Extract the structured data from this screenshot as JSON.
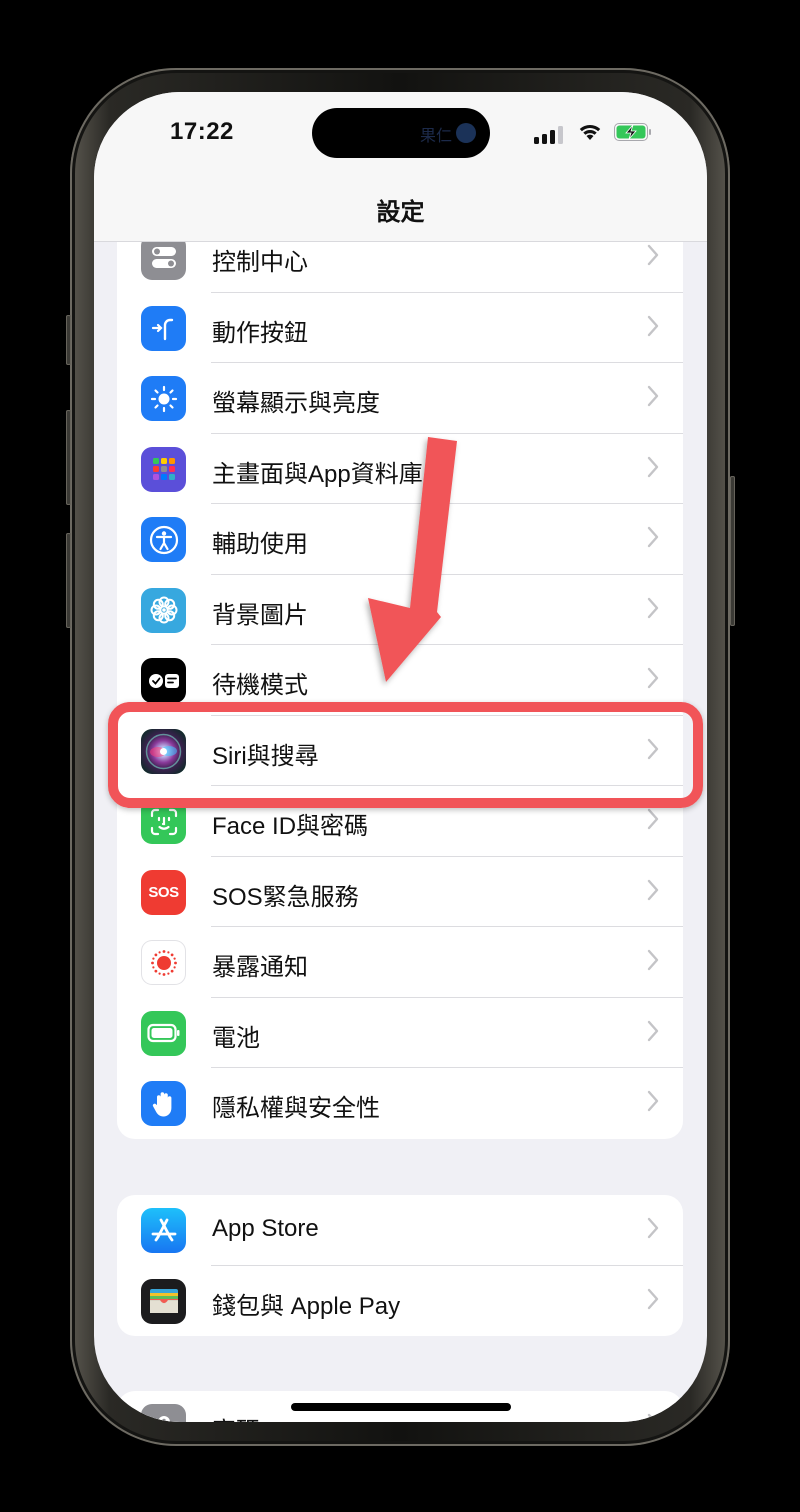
{
  "status_bar": {
    "time": "17:22",
    "island_text": "果仁",
    "signal_bars_filled": 3,
    "signal_bars_total": 4,
    "wifi": "wifi-icon",
    "battery": "battery-charging-icon",
    "battery_color": "#34c759"
  },
  "nav": {
    "title": "設定"
  },
  "sections": [
    {
      "items": [
        {
          "label": "控制中心",
          "icon": "control-center-icon",
          "color": "#8e8e93"
        },
        {
          "label": "動作按鈕",
          "icon": "action-button-icon",
          "color": "#1f7cf6"
        },
        {
          "label": "螢幕顯示與亮度",
          "icon": "brightness-icon",
          "color": "#1f7cf6"
        },
        {
          "label": "主畫面與App資料庫",
          "icon": "home-screen-icon",
          "color": "#5b4fd9"
        },
        {
          "label": "輔助使用",
          "icon": "accessibility-icon",
          "color": "#1f7cf6"
        },
        {
          "label": "背景圖片",
          "icon": "wallpaper-icon",
          "color": "#37a8df"
        },
        {
          "label": "待機模式",
          "icon": "standby-icon",
          "color": "#000000"
        },
        {
          "label": "Siri與搜尋",
          "icon": "siri-icon",
          "color": "#1a1a2e"
        },
        {
          "label": "Face ID與密碼",
          "icon": "face-id-icon",
          "color": "#34c759"
        },
        {
          "label": "SOS緊急服務",
          "icon": "sos-icon",
          "color": "#ef3b32",
          "icon_text": "SOS"
        },
        {
          "label": "暴露通知",
          "icon": "exposure-notification-icon",
          "color": "#ffffff"
        },
        {
          "label": "電池",
          "icon": "battery-icon",
          "color": "#34c759"
        },
        {
          "label": "隱私權與安全性",
          "icon": "privacy-hand-icon",
          "color": "#1f7cf6"
        }
      ]
    },
    {
      "items": [
        {
          "label": "App Store",
          "icon": "app-store-icon",
          "color": "#1a8cf5"
        },
        {
          "label": "錢包與 Apple Pay",
          "icon": "wallet-icon",
          "color": "#1c1c1e"
        }
      ]
    },
    {
      "items": [
        {
          "label": "密碼",
          "icon": "passwords-key-icon",
          "color": "#8e8e93"
        }
      ]
    }
  ],
  "annotation": {
    "highlighted_item": "Siri與搜尋",
    "arrow_color": "#f15458",
    "box_color": "#f15458"
  }
}
